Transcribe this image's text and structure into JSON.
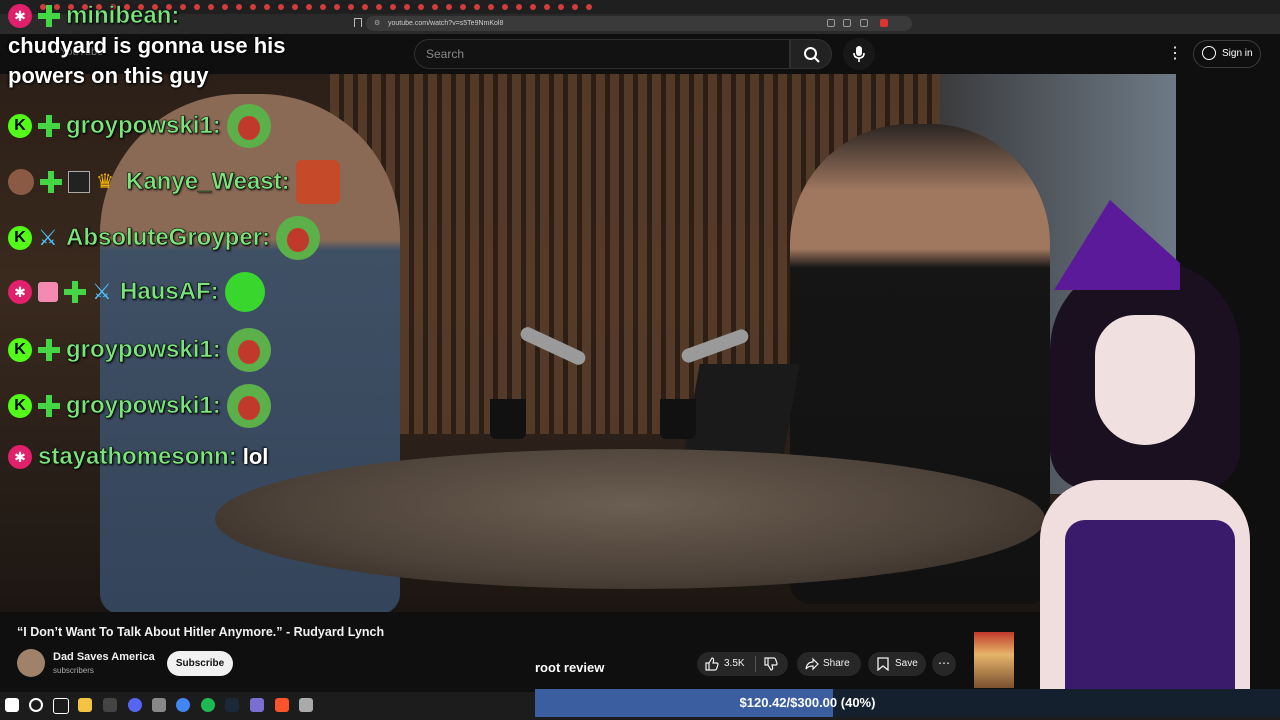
{
  "browser": {
    "url": "youtube.com/watch?v=s5Te9NmKol8"
  },
  "youtube": {
    "logo_text": "YouTube",
    "search_placeholder": "Search",
    "signin_label": "Sign in",
    "video_title": "“I Don’t Want To Talk About Hitler Anymore.” - Rudyard Lynch",
    "channel_name": "Dad Saves America",
    "subscribers_label": "subscribers",
    "subscribe_label": "Subscribe",
    "like_count": "3.5K",
    "share_label": "Share",
    "save_label": "Save"
  },
  "chat": {
    "messages": [
      {
        "user": "minibean:",
        "text": ""
      },
      {
        "user": "",
        "text": "chudyard is gonna use his"
      },
      {
        "user": "",
        "text": "powers on this guy"
      },
      {
        "user": "groypowski1:",
        "text": ""
      },
      {
        "user": "Kanye_Weast:",
        "text": ""
      },
      {
        "user": "AbsoluteGroyper:",
        "text": ""
      },
      {
        "user": "HausAF:",
        "text": ""
      },
      {
        "user": "groypowski1:",
        "text": ""
      },
      {
        "user": "groypowski1:",
        "text": ""
      },
      {
        "user": "stayathomesonn:",
        "text": "lol"
      }
    ],
    "badge_letter": "K"
  },
  "overlay": {
    "stream_label": "root review",
    "donation_text": "$120.42/$300.00 (40%)",
    "donation_progress": 0.4
  },
  "colors": {
    "kick_green": "#53fc18",
    "username_green": "#7be37b",
    "donation_fill": "#3a5ea0"
  }
}
